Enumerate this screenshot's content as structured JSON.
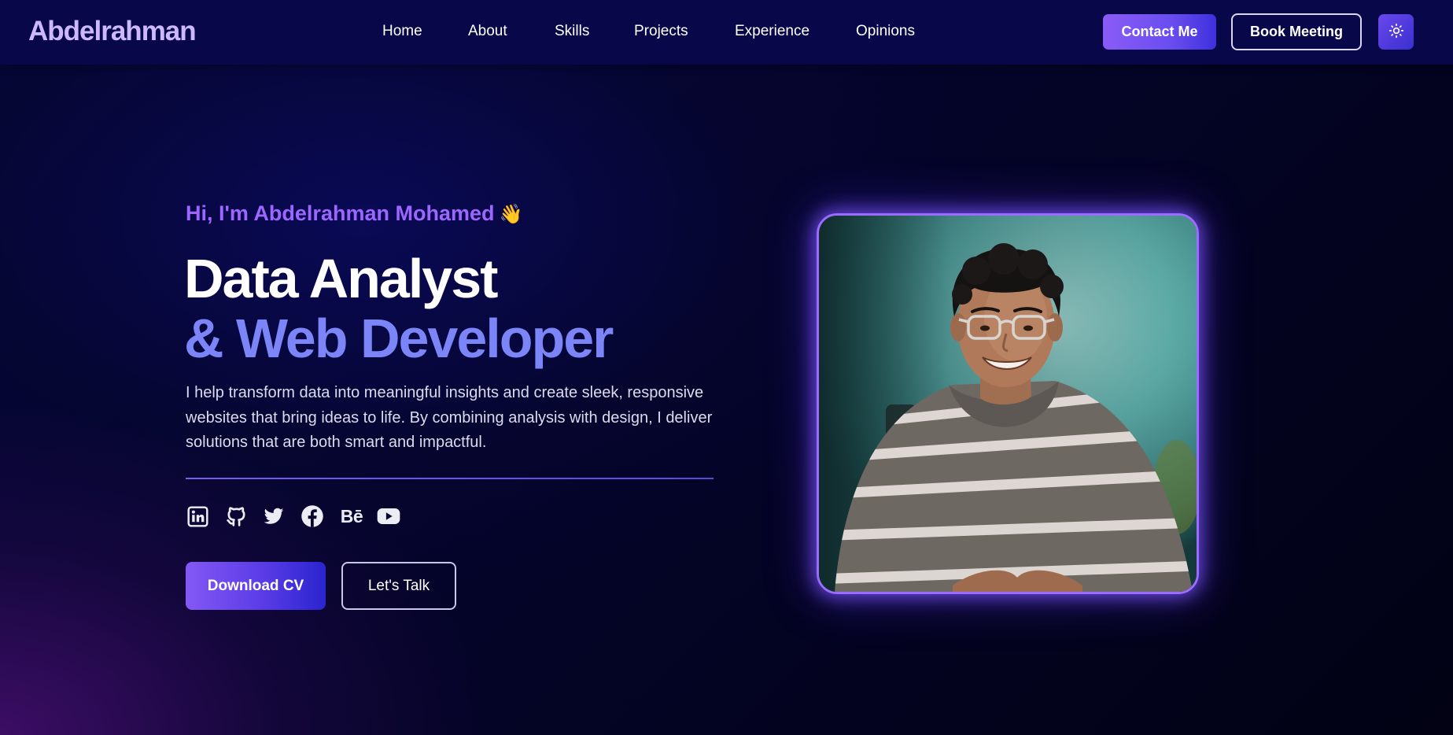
{
  "nav": {
    "logo": "Abdelrahman",
    "links": [
      "Home",
      "About",
      "Skills",
      "Projects",
      "Experience",
      "Opinions"
    ],
    "contact_label": "Contact Me",
    "book_label": "Book Meeting",
    "theme_icon": "sun-icon"
  },
  "hero": {
    "greeting": "Hi, I'm Abdelrahman Mohamed",
    "greeting_emoji": "👋",
    "title_line1": "Data Analyst",
    "title_line2": "& Web Developer",
    "description": "I help transform data into meaningful insights and create sleek, responsive websites that bring ideas to life. By combining analysis with design, I deliver solutions that are both smart and impactful.",
    "socials": [
      {
        "icon": "linkedin-icon"
      },
      {
        "icon": "github-icon"
      },
      {
        "icon": "twitter-icon"
      },
      {
        "icon": "facebook-icon"
      },
      {
        "icon": "behance-icon",
        "text": "Bē"
      },
      {
        "icon": "youtube-icon"
      }
    ],
    "cv_label": "Download CV",
    "talk_label": "Let's Talk"
  },
  "colors": {
    "accent": "#8a5cf6",
    "title_gradient": "#7c85f7",
    "greeting": "#9d67ff",
    "nav_bg": "#07074a"
  }
}
